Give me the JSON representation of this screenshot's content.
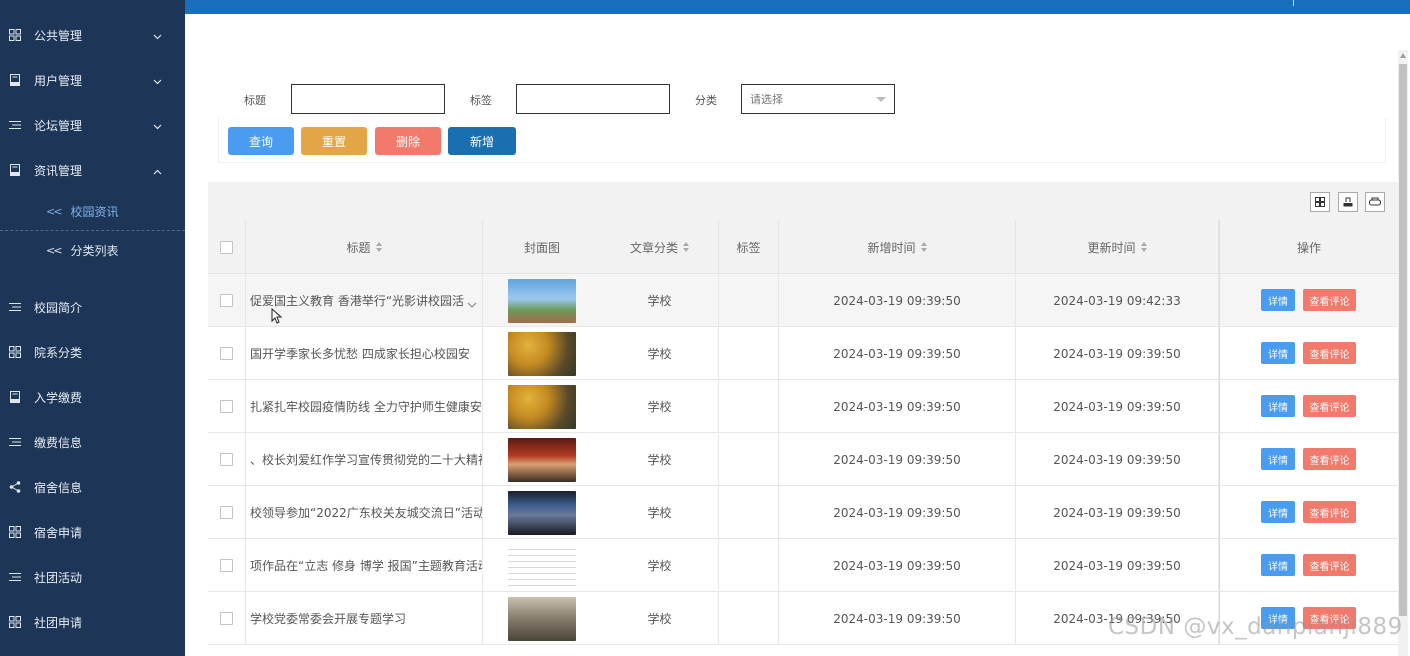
{
  "sidebar": {
    "items": [
      {
        "label": "公共管理",
        "icon": "grid-icon",
        "arrow": "down"
      },
      {
        "label": "用户管理",
        "icon": "book-icon",
        "arrow": "down"
      },
      {
        "label": "论坛管理",
        "icon": "list-icon",
        "arrow": "down"
      },
      {
        "label": "资讯管理",
        "icon": "book-icon",
        "arrow": "up"
      }
    ],
    "sub_items": [
      {
        "label": "校园资讯",
        "active": true
      },
      {
        "label": "分类列表",
        "active": false
      }
    ],
    "items_bottom": [
      {
        "label": "校园简介",
        "icon": "list-icon"
      },
      {
        "label": "院系分类",
        "icon": "grid-icon"
      },
      {
        "label": "入学缴费",
        "icon": "book-icon"
      },
      {
        "label": "缴费信息",
        "icon": "list-icon"
      },
      {
        "label": "宿舍信息",
        "icon": "share-icon"
      },
      {
        "label": "宿舍申请",
        "icon": "grid-icon"
      },
      {
        "label": "社团活动",
        "icon": "list-icon"
      },
      {
        "label": "社团申请",
        "icon": "grid-icon"
      }
    ]
  },
  "filter": {
    "title_label": "标题",
    "tag_label": "标签",
    "category_label": "分类",
    "category_placeholder": "请选择"
  },
  "buttons": {
    "search": "查询",
    "reset": "重置",
    "delete": "删除",
    "add": "新增"
  },
  "colors": {
    "search": "#4a9cf0",
    "reset": "#e3a545",
    "delete": "#f17a6c",
    "add": "#1a6fb0",
    "detail": "#4a9cf0",
    "comment": "#f17a6c",
    "sidebar": "#1d3557",
    "topbar": "#1a6fbd"
  },
  "table": {
    "headers": {
      "title": "标题",
      "cover": "封面图",
      "category": "文章分类",
      "tag": "标签",
      "created": "新增时间",
      "updated": "更新时间",
      "ops": "操作"
    },
    "detail_label": "详情",
    "comment_label": "查看评论",
    "rows": [
      {
        "title": "促爱国主义教育 香港举行“光影讲校园活",
        "category": "学校",
        "tag": "",
        "created": "2024-03-19 09:39:50",
        "updated": "2024-03-19 09:42:33",
        "img": "sky"
      },
      {
        "title": "国开学季家长多忧愁 四成家长担心校园安",
        "category": "学校",
        "tag": "",
        "created": "2024-03-19 09:39:50",
        "updated": "2024-03-19 09:39:50",
        "img": "autumn"
      },
      {
        "title": "扎紧扎牢校园疫情防线 全力守护师生健康安全",
        "category": "学校",
        "tag": "",
        "created": "2024-03-19 09:39:50",
        "updated": "2024-03-19 09:39:50",
        "img": "autumn"
      },
      {
        "title": "、校长刘爱红作学习宣传贯彻党的二十大精神",
        "category": "学校",
        "tag": "",
        "created": "2024-03-19 09:39:50",
        "updated": "2024-03-19 09:39:50",
        "img": "hall"
      },
      {
        "title": "校领导参加“2022广东校关友城交流日”活动",
        "category": "学校",
        "tag": "",
        "created": "2024-03-19 09:39:50",
        "updated": "2024-03-19 09:39:50",
        "img": "screen"
      },
      {
        "title": "项作品在“立志 修身 博学 报国”主题教育活动",
        "category": "学校",
        "tag": "",
        "created": "2024-03-19 09:39:50",
        "updated": "2024-03-19 09:39:50",
        "img": "doc"
      },
      {
        "title": "学校党委常委会开展专题学习",
        "category": "学校",
        "tag": "",
        "created": "2024-03-19 09:39:50",
        "updated": "2024-03-19 09:39:50",
        "img": "meeting"
      }
    ]
  },
  "watermark": "CSDN @vx_danpianji889"
}
